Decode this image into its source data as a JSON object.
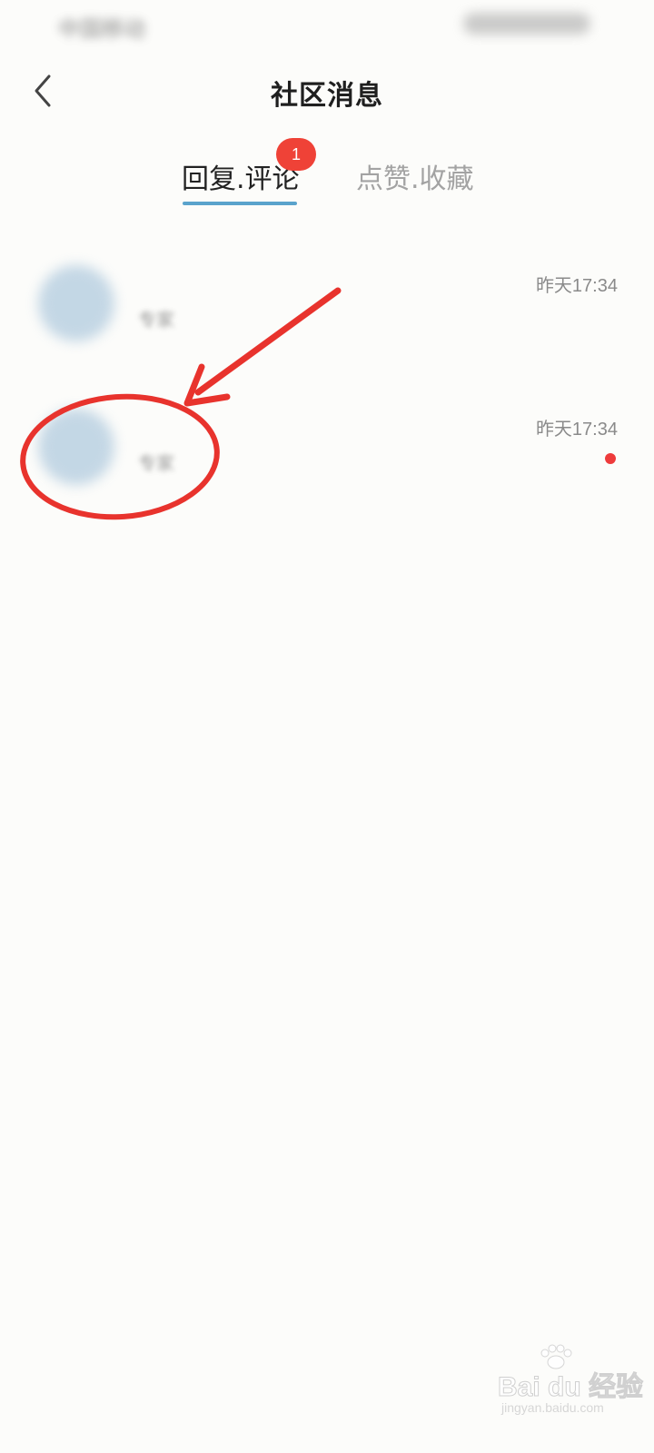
{
  "status_bar": {
    "carrier": "中国移动"
  },
  "header": {
    "back_icon": "chevron-left-icon",
    "title": "社区消息"
  },
  "tabs": [
    {
      "label": "回复.评论",
      "badge": "1",
      "active": true
    },
    {
      "label": "点赞.收藏",
      "active": false
    }
  ],
  "messages": [
    {
      "name": "专家",
      "time": "昨天17:34",
      "unread": false
    },
    {
      "name": "专家",
      "time": "昨天17:34",
      "unread": true
    }
  ],
  "colors": {
    "accent_underline": "#5aa3cc",
    "badge_red": "#ef4237",
    "annotation_red": "#e8332d",
    "unread_dot": "#ee3b3b"
  },
  "watermark": {
    "brand": "Bai du 经验",
    "url": "jingyan.baidu.com"
  }
}
